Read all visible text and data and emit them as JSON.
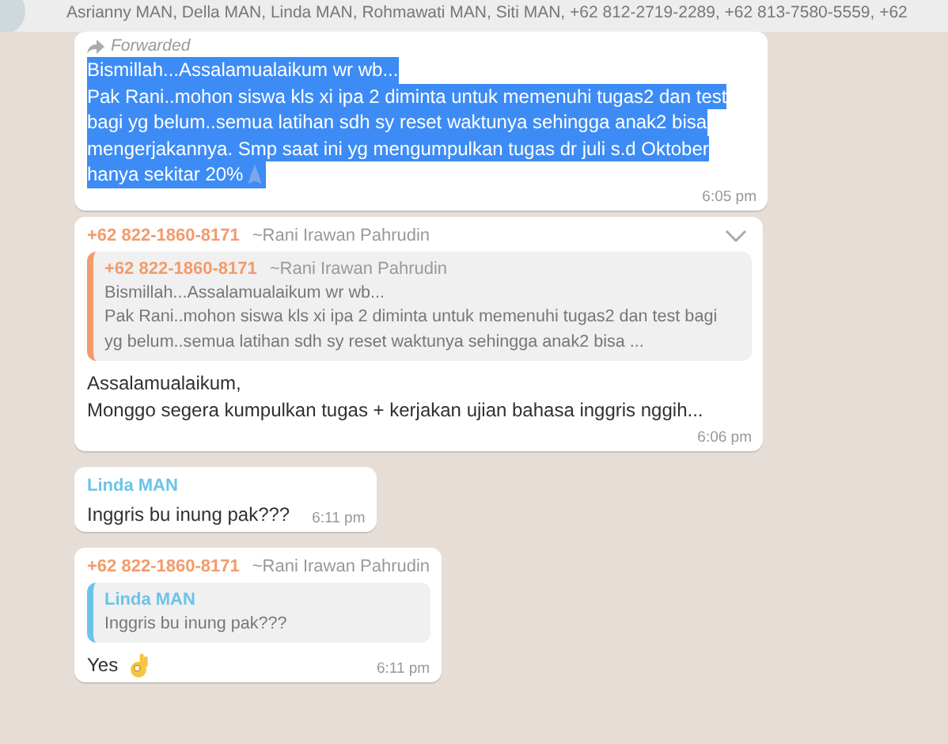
{
  "header": {
    "participants": "Asrianny MAN, Della MAN, Linda MAN, Rohmawati MAN, Siti MAN, +62 812-2719-2289, +62 813-7580-5559, +62"
  },
  "messages": [
    {
      "kind": "forwarded",
      "forwarded_label": "Forwarded",
      "selected": true,
      "lines": [
        "Bismillah...Assalamualaikum wr wb...",
        "Pak Rani..mohon siswa kls xi ipa 2 diminta untuk memenuhi tugas2 dan test",
        "bagi yg belum..semua latihan sdh sy reset waktunya sehingga anak2 bisa",
        "mengerjakannya. Smp saat ini yg mengumpulkan tugas dr juli s.d Oktober",
        "hanya sekitar 20%"
      ],
      "emoji_icon": true,
      "time": "6:05 pm"
    },
    {
      "kind": "reply",
      "sender": "+62 822-1860-8171",
      "color": "#f29b6b",
      "sender_name": "~Rani Irawan Pahrudin",
      "menu": true,
      "quote": {
        "sender": "+62 822-1860-8171",
        "color": "#f29b6b",
        "sender_name": "~Rani Irawan Pahrudin",
        "lines": [
          "Bismillah...Assalamualaikum wr wb...",
          "Pak Rani..mohon siswa kls xi ipa 2 diminta untuk memenuhi tugas2 dan test bagi",
          "yg belum..semua latihan sdh sy reset waktunya sehingga anak2 bisa ..."
        ]
      },
      "lines": [
        "Assalamualaikum,",
        "Monggo segera kumpulkan tugas + kerjakan ujian bahasa inggris nggih..."
      ],
      "emoji_icon": false,
      "time": "6:06 pm"
    },
    {
      "kind": "text",
      "sender": "Linda MAN",
      "color": "#6bc4e8",
      "lines": [
        "Inggris bu inung pak???"
      ],
      "time": "6:11 pm"
    },
    {
      "kind": "reply",
      "sender": "+62 822-1860-8171",
      "color": "#f29b6b",
      "sender_name": "~Rani Irawan Pahrudin",
      "menu": false,
      "quote": {
        "sender": "Linda MAN",
        "color": "#6bc4e8",
        "lines": [
          "Inggris bu inung pak???"
        ]
      },
      "lines": [
        "Yes"
      ],
      "emoji_icon": true,
      "time": "6:11 pm"
    }
  ]
}
